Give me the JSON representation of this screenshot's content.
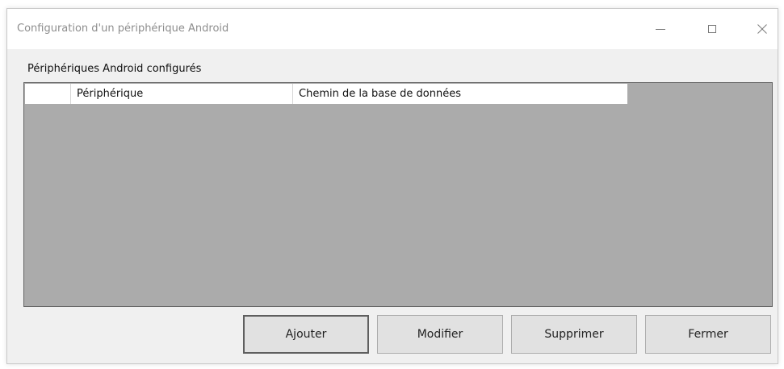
{
  "window": {
    "title": "Configuration d'un périphérique Android"
  },
  "group": {
    "label": "Périphériques Android configurés"
  },
  "grid": {
    "columns": [
      "",
      "Périphérique",
      "Chemin de la base de données"
    ],
    "rows": []
  },
  "buttons": {
    "add": "Ajouter",
    "edit": "Modifier",
    "delete": "Supprimer",
    "close": "Fermer"
  },
  "icons": {
    "minimize": "minimize-icon",
    "maximize": "maximize-icon",
    "close": "close-icon"
  }
}
